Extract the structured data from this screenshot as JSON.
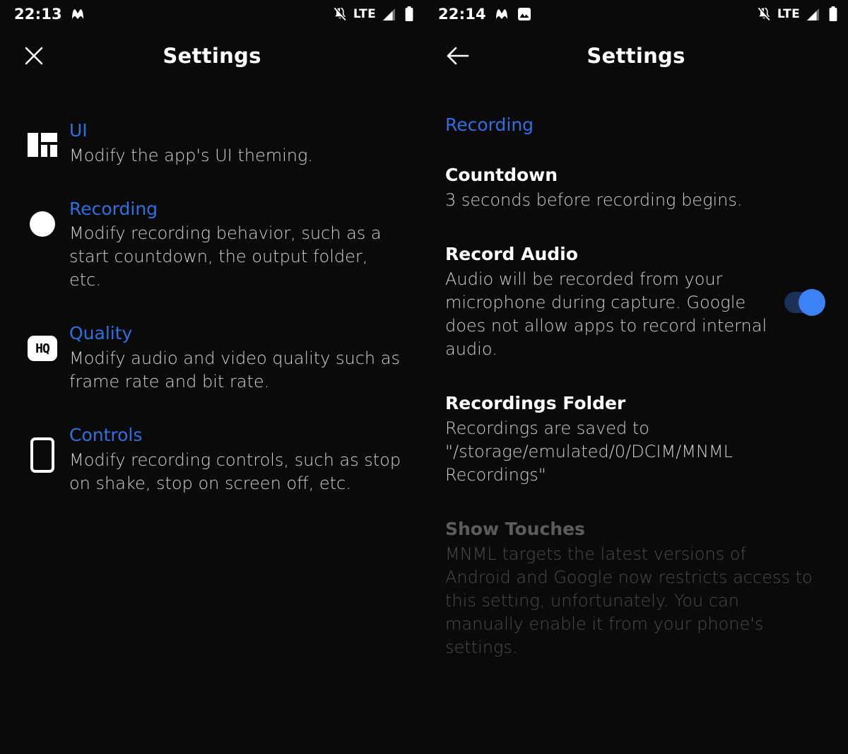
{
  "left_panel": {
    "statusbar": {
      "time": "22:13",
      "app_logo_icon": "mnml-logo-icon",
      "icons": [
        "notifications-off-icon",
        "signal-cellular-icon",
        "battery-icon"
      ],
      "network_label": "LTE"
    },
    "appbar": {
      "nav_icon": "close-icon",
      "title": "Settings"
    },
    "items": [
      {
        "icon": "dashboard-layout-icon",
        "title": "UI",
        "description": "Modify the app's UI theming."
      },
      {
        "icon": "record-circle-icon",
        "title": "Recording",
        "description": "Modify recording behavior, such as a start countdown, the output folder, etc."
      },
      {
        "icon": "hq-quality-icon",
        "title": "Quality",
        "description": "Modify audio and video quality such as frame rate and bit rate."
      },
      {
        "icon": "phone-outline-icon",
        "title": "Controls",
        "description": "Modify recording controls, such as stop on shake, stop on screen off, etc."
      }
    ]
  },
  "right_panel": {
    "statusbar": {
      "time": "22:14",
      "app_logo_icon": "mnml-logo-icon",
      "gallery_icon": "image-gallery-icon",
      "icons": [
        "notifications-off-icon",
        "signal-cellular-icon",
        "battery-icon"
      ],
      "network_label": "LTE"
    },
    "appbar": {
      "nav_icon": "back-arrow-icon",
      "title": "Settings"
    },
    "category": "Recording",
    "preferences": [
      {
        "title": "Countdown",
        "summary": "3 seconds before recording begins.",
        "has_switch": false,
        "enabled": true
      },
      {
        "title": "Record Audio",
        "summary": "Audio will be recorded from your microphone during capture. Google does not allow apps to record internal audio.",
        "has_switch": true,
        "switch_on": true,
        "enabled": true
      },
      {
        "title": "Recordings Folder",
        "summary": "Recordings are saved to \"/storage/emulated/0/DCIM/MNML Recordings\"",
        "has_switch": false,
        "enabled": true
      },
      {
        "title": "Show Touches",
        "summary": "MNML targets the latest versions of Android and Google now restricts access to this setting, unfortunately. You can manually enable it from your phone's settings.",
        "has_switch": false,
        "enabled": false
      }
    ]
  },
  "colors": {
    "background": "#0a0a0a",
    "accent_blue": "#2f6fe0",
    "switch_track": "#1d3057",
    "switch_thumb": "#3b82f6",
    "primary_text": "#ffffff",
    "secondary_text": "#cfcfcf",
    "disabled_text": "#5c5c5c"
  }
}
